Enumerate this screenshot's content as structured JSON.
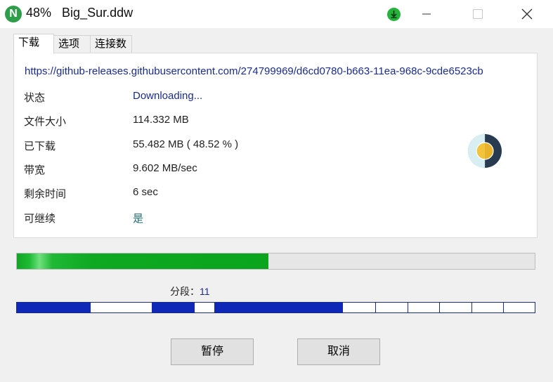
{
  "window": {
    "logo_letter": "N",
    "percent": "48%",
    "filename": "Big_Sur.ddw",
    "icons": {
      "logo": "app-logo-icon",
      "status": "download-arrow-icon",
      "minimize": "minimize-icon",
      "maximize": "maximize-icon",
      "close": "close-icon"
    }
  },
  "tabs": [
    {
      "label": "下载",
      "active": true
    },
    {
      "label": "选项",
      "active": false
    },
    {
      "label": "连接数",
      "active": false
    }
  ],
  "download": {
    "url": "https://github-releases.githubusercontent.com/274799969/d6cd0780-b663-11ea-968c-9cde6523cb",
    "rows": [
      {
        "label": "状态",
        "value": "Downloading..."
      },
      {
        "label": "文件大小",
        "value": "114.332 MB"
      },
      {
        "label": "已下载",
        "value": "55.482 MB ( 48.52 % )"
      },
      {
        "label": "带宽",
        "value": "9.602 MB/sec"
      },
      {
        "label": "剩余时间",
        "value": "6 sec"
      },
      {
        "label": "可继续",
        "value": "是"
      }
    ],
    "progress_percent": 48.52,
    "pie_icon": "progress-pie-icon"
  },
  "segments": {
    "label": "分段：",
    "count": "11",
    "map_fraction_ranges": [
      [
        0,
        0.143
      ],
      [
        0.261,
        0.343
      ],
      [
        0.381,
        0.63
      ]
    ],
    "divider_fractions": [
      0.692,
      0.754,
      0.816,
      0.878,
      0.939
    ]
  },
  "buttons": {
    "pause": "暂停",
    "cancel": "取消"
  },
  "colors": {
    "accent_green": "#0ea821",
    "segment_blue": "#1028b8",
    "link_blue": "#1a2c8a"
  }
}
